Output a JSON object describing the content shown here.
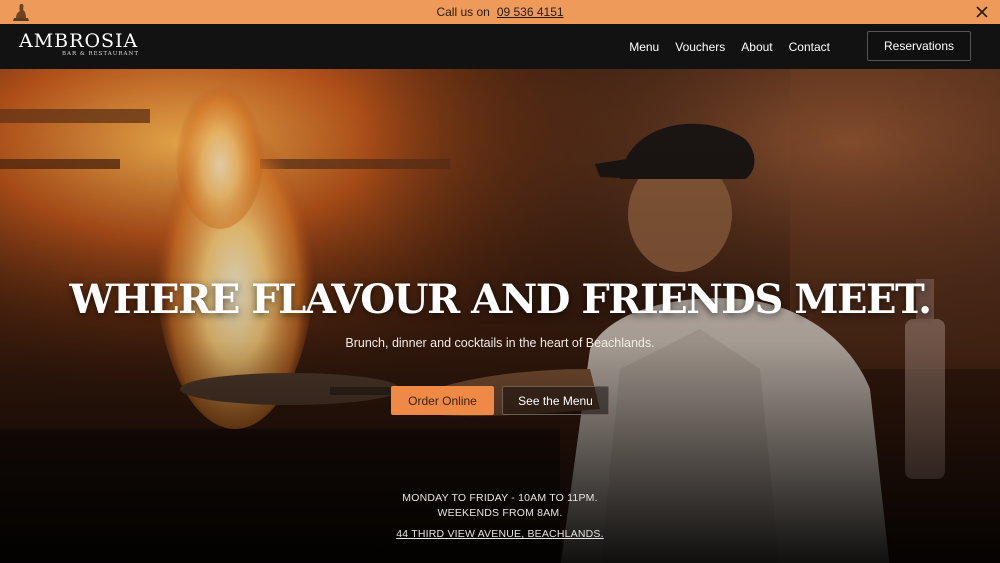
{
  "topbar": {
    "call_label": "Call us on",
    "phone": "09 536 4151"
  },
  "brand": {
    "name": "AMBROSIA",
    "tagline": "BAR & RESTAURANT"
  },
  "nav": {
    "links": [
      "Menu",
      "Vouchers",
      "About",
      "Contact"
    ],
    "reservations": "Reservations"
  },
  "hero": {
    "headline": "WHERE FLAVOUR AND FRIENDS MEET.",
    "subline": "Brunch, dinner and cocktails in the heart of Beachlands.",
    "order_button": "Order Online",
    "menu_button": "See the Menu",
    "hours_line1": "MONDAY TO FRIDAY - 10AM TO 11PM.",
    "hours_line2": "WEEKENDS FROM 8AM.",
    "address": "44 THIRD VIEW AVENUE, BEACHLANDS."
  },
  "colors": {
    "topbar": "#ee9a5b",
    "nav": "#121212",
    "accent": "#ee8a45"
  },
  "icons": [
    "statue-icon",
    "close-icon"
  ]
}
